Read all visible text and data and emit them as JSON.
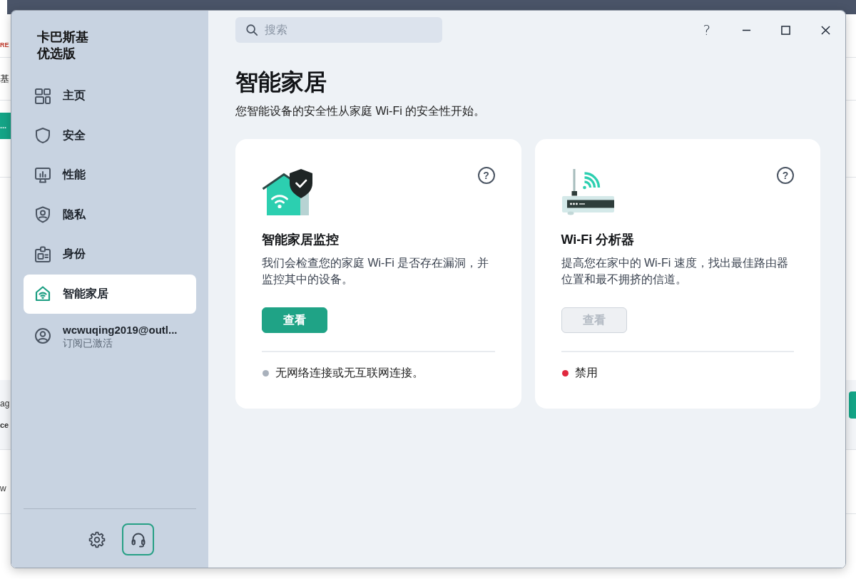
{
  "background_page": {
    "tag": "RE",
    "heading": "基",
    "button": "...",
    "dropzone": {
      "text": "ag",
      "note": "ce"
    },
    "row_text": "w"
  },
  "sidebar": {
    "title": "卡巴斯基优选版",
    "items": [
      {
        "label": "主页",
        "selected": false
      },
      {
        "label": "安全",
        "selected": false
      },
      {
        "label": "性能",
        "selected": false
      },
      {
        "label": "隐私",
        "selected": false
      },
      {
        "label": "身份",
        "selected": false
      },
      {
        "label": "智能家居",
        "selected": true
      }
    ],
    "account": {
      "name": "wcwuqing2019@outl...",
      "status": "订阅已激活"
    },
    "footer_buttons": [
      {
        "focused": false
      },
      {
        "focused": true
      }
    ]
  },
  "main": {
    "search": {
      "placeholder": "搜索"
    },
    "help_label": "?",
    "title": "智能家居",
    "subtitle": "您智能设备的安全性从家庭 Wi-Fi 的安全性开始。",
    "cards": [
      {
        "title": "智能家居监控",
        "description": "我们会检查您的家庭 Wi-Fi 是否存在漏洞，并监控其中的设备。",
        "help": "?",
        "button": {
          "label": "查看",
          "disabled": false
        },
        "status": {
          "text": "无网络连接或无互联网连接。",
          "color": "#a9b1bc"
        }
      },
      {
        "title": "Wi-Fi 分析器",
        "description": "提高您在家中的 Wi-Fi 速度，找出最佳路由器位置和最不拥挤的信道。",
        "help": "?",
        "button": {
          "label": "查看",
          "disabled": true
        },
        "status": {
          "text": "禁用",
          "color": "#e0283e"
        }
      }
    ]
  }
}
